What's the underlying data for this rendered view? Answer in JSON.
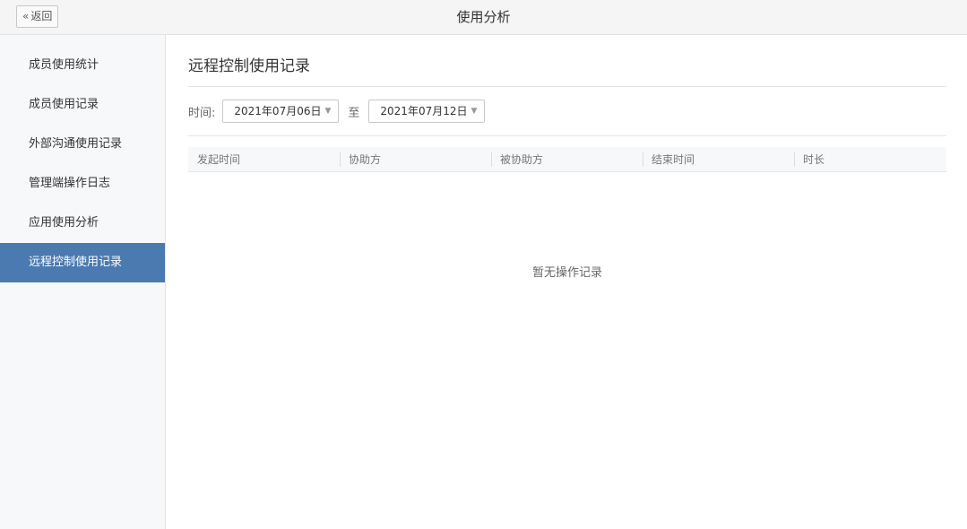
{
  "header": {
    "back_label": "返回",
    "title": "使用分析"
  },
  "sidebar": {
    "items": [
      {
        "label": "成员使用统计",
        "active": false
      },
      {
        "label": "成员使用记录",
        "active": false
      },
      {
        "label": "外部沟通使用记录",
        "active": false
      },
      {
        "label": "管理端操作日志",
        "active": false
      },
      {
        "label": "应用使用分析",
        "active": false
      },
      {
        "label": "远程控制使用记录",
        "active": true
      }
    ]
  },
  "main": {
    "title": "远程控制使用记录",
    "filter": {
      "time_label": "时间:",
      "start_date": "2021年07月06日",
      "to_label": "至",
      "end_date": "2021年07月12日"
    },
    "table": {
      "columns": [
        "发起时间",
        "协助方",
        "被协助方",
        "结束时间",
        "时长"
      ],
      "rows": []
    },
    "empty_text": "暂无操作记录"
  },
  "icons": {
    "back": "double-chevron-left-icon",
    "dropdown": "triangle-down-icon"
  },
  "colors": {
    "active_nav": "#4a7ab0",
    "sidebar_bg": "#f7f8fa",
    "topbar_bg": "#f5f5f6"
  }
}
